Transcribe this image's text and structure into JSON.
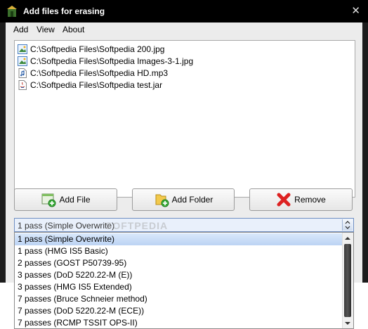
{
  "window": {
    "title": "Add files for erasing",
    "close_glyph": "✕"
  },
  "menu": {
    "items": [
      "Add",
      "View",
      "About"
    ]
  },
  "files": [
    {
      "path": "C:\\Softpedia Files\\Softpedia 200.jpg",
      "icon": "image-file-icon"
    },
    {
      "path": "C:\\Softpedia Files\\Softpedia Images-3-1.jpg",
      "icon": "image-file-icon"
    },
    {
      "path": "C:\\Softpedia Files\\Softpedia HD.mp3",
      "icon": "audio-file-icon"
    },
    {
      "path": "C:\\Softpedia Files\\Softpedia test.jar",
      "icon": "java-file-icon"
    }
  ],
  "buttons": {
    "add_file": "Add File",
    "add_folder": "Add Folder",
    "remove": "Remove"
  },
  "combo": {
    "selected": "1 pass (Simple Overwrite)"
  },
  "dropdown": {
    "options": [
      "1 pass (Simple Overwrite)",
      "1 pass (HMG IS5 Basic)",
      "2 passes (GOST P50739-95)",
      "3 passes (DoD 5220.22-M (E))",
      "3 passes (HMG IS5 Extended)",
      "7 passes (Bruce Schneier method)",
      "7 passes (DoD 5220.22-M (ECE))",
      "7 passes (RCMP TSSIT OPS-II)"
    ],
    "selected_index": 0
  },
  "watermark": "SOFTPEDIA",
  "colors": {
    "titlebar": "#000000",
    "frame": "#1c1c1c",
    "client": "#ececec",
    "selection": "#c6daf5"
  }
}
